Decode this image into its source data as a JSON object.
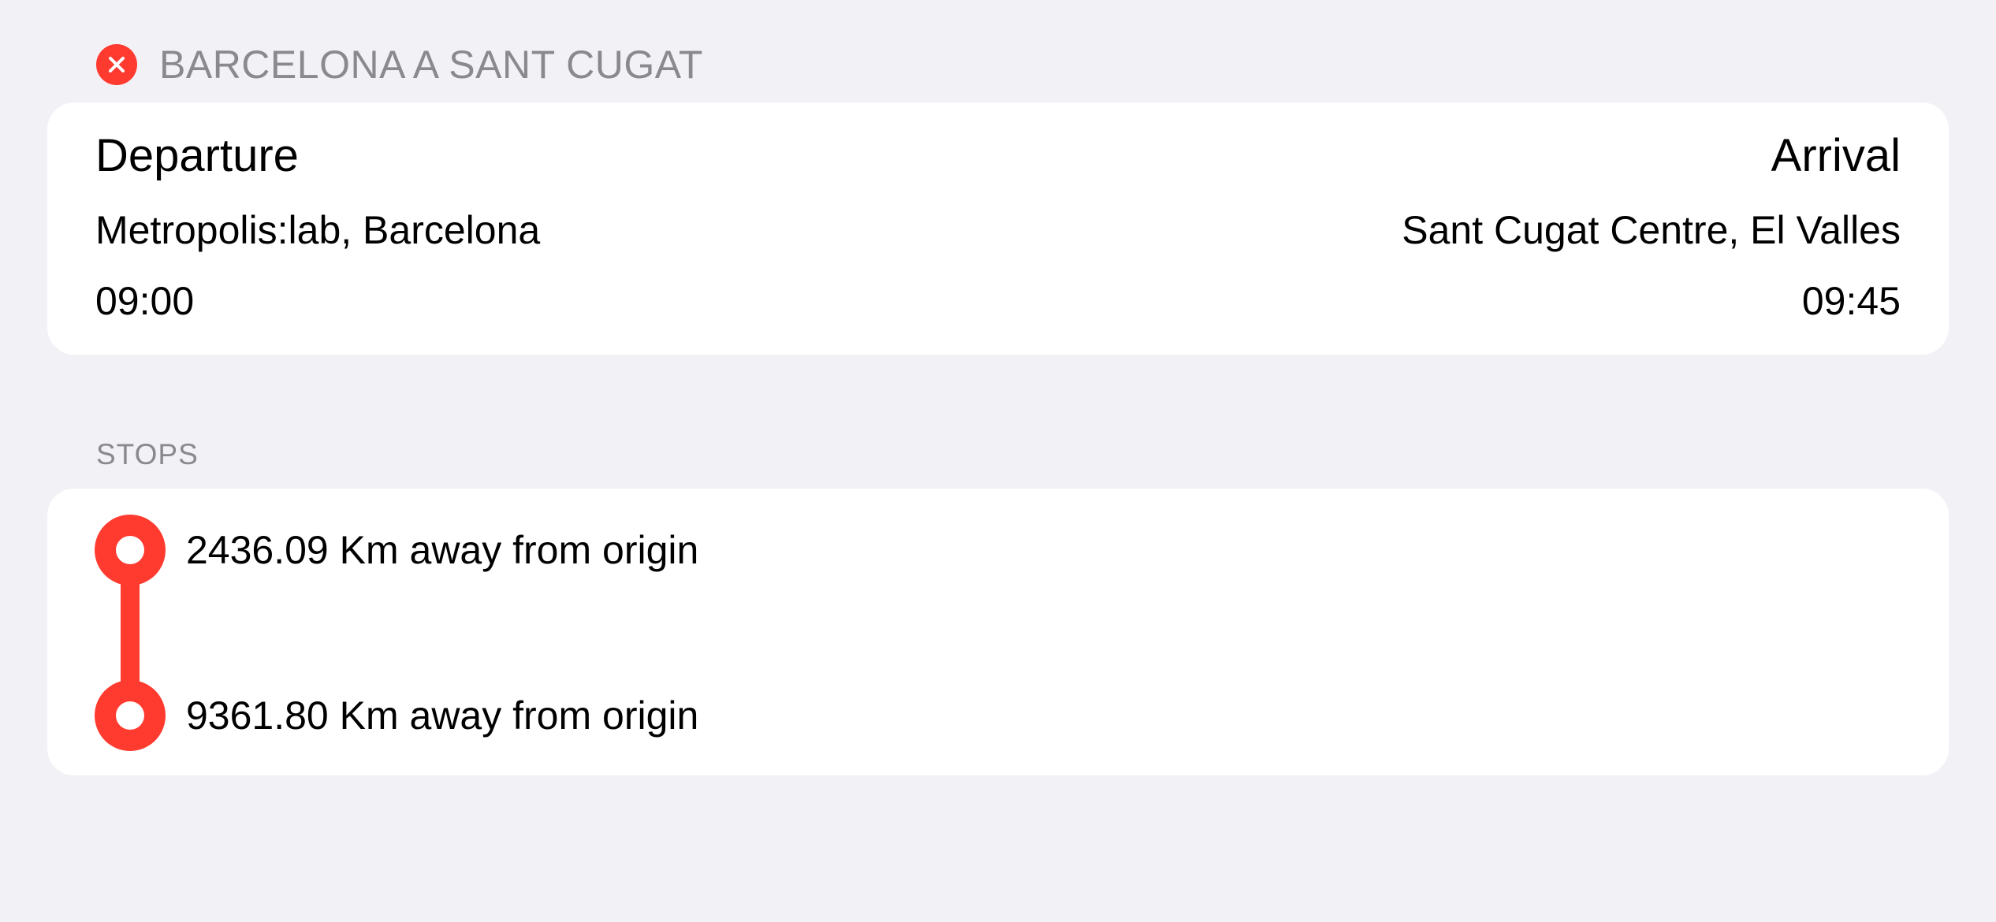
{
  "header": {
    "title": "BARCELONA A SANT CUGAT",
    "close_icon": "xmark-circle-fill-icon"
  },
  "trip": {
    "departure_label": "Departure",
    "arrival_label": "Arrival",
    "departure_place": "Metropolis:lab, Barcelona",
    "arrival_place": "Sant Cugat Centre, El Valles",
    "departure_time": "09:00",
    "arrival_time": "09:45"
  },
  "stops": {
    "section_label": "STOPS",
    "items": [
      {
        "label": "2436.09 Km away from origin"
      },
      {
        "label": "9361.80 Km away from origin"
      }
    ]
  },
  "colors": {
    "accent": "#ff3b30",
    "background": "#f2f1f6",
    "card": "#ffffff",
    "secondary_text": "#8a8a8e"
  }
}
